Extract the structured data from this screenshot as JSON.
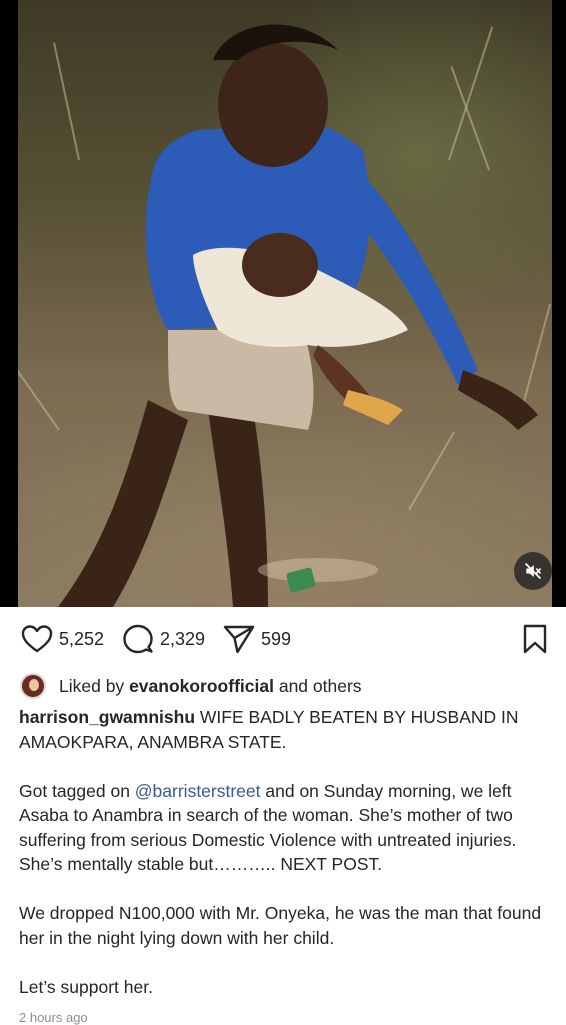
{
  "post": {
    "likes": "5,252",
    "comments": "2,329",
    "shares": "599"
  },
  "liked_by": {
    "prefix": "Liked by",
    "user": "evanokoroofficial",
    "suffix": "and others"
  },
  "caption": {
    "username": "harrison_gwamnishu",
    "headline": "WIFE BADLY BEATEN BY HUSBAND IN AMAOKPARA, ANAMBRA STATE.",
    "para1_before": "Got tagged on ",
    "para1_mention": "@barristerstreet",
    "para1_after": " and on Sunday morning, we left Asaba to Anambra in search of the woman. She’s mother of two suffering from serious Domestic Violence with untreated injuries. She’s mentally stable but……….. NEXT POST.",
    "para2": "We dropped N100,000 with Mr. Onyeka, he was the man that found her in the night lying down with her child.",
    "para3": "Let’s support her."
  },
  "timestamp": "2 hours ago",
  "icons": {
    "like": "heart-icon",
    "comment": "comment-bubble-icon",
    "share": "send-icon",
    "save": "bookmark-icon",
    "mute": "speaker-muted-icon"
  }
}
